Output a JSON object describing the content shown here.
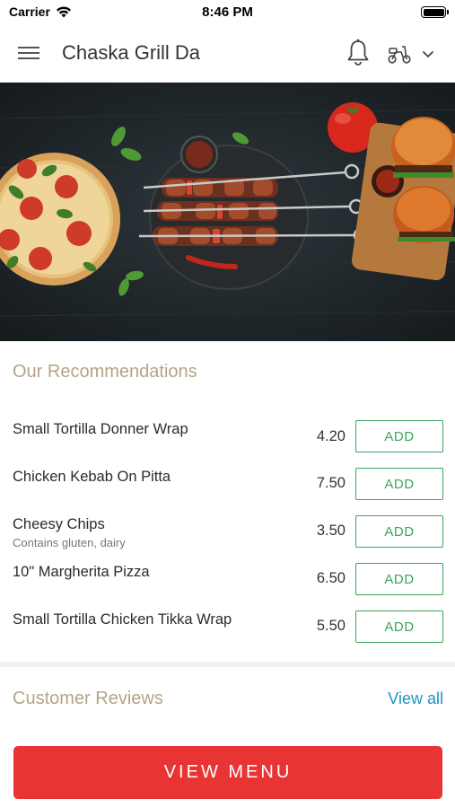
{
  "status_bar": {
    "carrier": "Carrier",
    "time": "8:46 PM"
  },
  "header": {
    "title": "Chaska Grill Da",
    "icons": {
      "menu": "hamburger-menu-icon",
      "notification": "bell-icon",
      "delivery": "scooter-icon",
      "dropdown": "chevron-down-icon"
    }
  },
  "hero": {
    "image": "food-banner"
  },
  "recommendations": {
    "title": "Our Recommendations",
    "add_label": "ADD",
    "items": [
      {
        "name": "Small Tortilla Donner Wrap",
        "note": "",
        "price": "4.20"
      },
      {
        "name": "Chicken Kebab On Pitta",
        "note": "",
        "price": "7.50"
      },
      {
        "name": "Cheesy Chips",
        "note": "Contains gluten, dairy",
        "price": "3.50"
      },
      {
        "name": "10\" Margherita Pizza",
        "note": "",
        "price": "6.50"
      },
      {
        "name": "Small Tortilla Chicken Tikka Wrap",
        "note": "",
        "price": "5.50"
      }
    ]
  },
  "reviews": {
    "title": "Customer Reviews",
    "view_all": "View all"
  },
  "cta": {
    "view_menu": "VIEW MENU"
  },
  "colors": {
    "accent_red": "#e93434",
    "add_green": "#3da35d",
    "section_title": "#b4a486",
    "link_blue": "#1f94c2"
  }
}
